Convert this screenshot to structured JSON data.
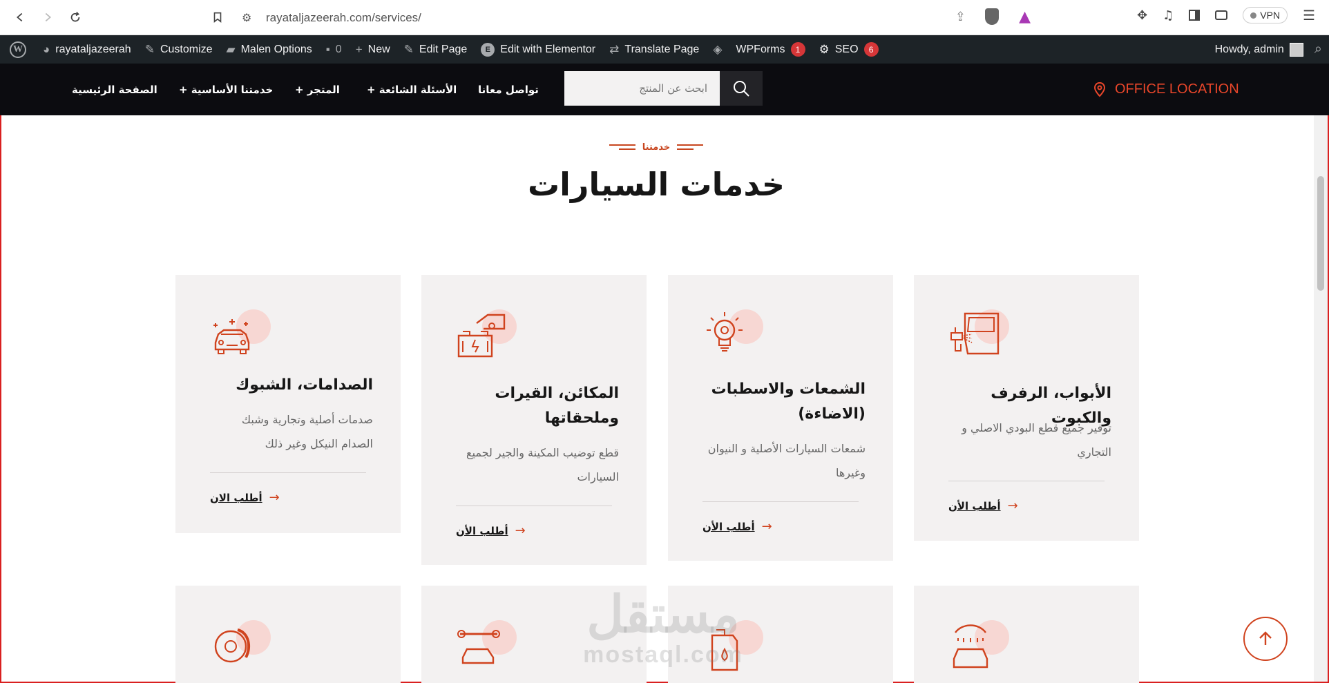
{
  "browser": {
    "url": "rayataljazeerah.com/services/",
    "vpn_label": "VPN"
  },
  "wp_admin": {
    "site": "rayataljazeerah",
    "customize": "Customize",
    "theme_options": "Malen Options",
    "comments": "0",
    "new": "New",
    "edit_page": "Edit Page",
    "edit_elementor": "Edit with Elementor",
    "translate": "Translate Page",
    "wpforms": "WPForms",
    "wpforms_count": "1",
    "seo": "SEO",
    "seo_count": "6",
    "howdy": "Howdy, admin"
  },
  "header": {
    "menu": [
      "الصفحة الرئيسية",
      "خدمتنا الأساسية +",
      "المتجر +",
      "الأسئلة الشائعة +",
      "تواصل معانا"
    ],
    "search_placeholder": "ابحث عن المنتج",
    "office": "OFFICE LOCATION"
  },
  "section": {
    "eyebrow": "خدمتنا",
    "title": "خدمات السيارات"
  },
  "cards": [
    {
      "title": "الصدامات، الشبوك",
      "desc": "صدمات أصلية وتجارية وشبك الصدام النيكل وغير ذلك",
      "link": "أطلب الان",
      "icon": "car-sparkle-icon"
    },
    {
      "title": "المكائن، القيرات وملحقاتها",
      "desc": "قطع توضيب المكينة والجير لجميع السيارات",
      "link": "أطلب الأن",
      "icon": "engine-battery-icon"
    },
    {
      "title": "الشمعات والاسطبات (الاضاءة)",
      "desc": "شمعات السيارات الأصلية و النيوان وغيرها",
      "link": "أطلب الأن",
      "icon": "lightbulb-icon"
    },
    {
      "title": "الأبواب، الرفرف والكبوت",
      "desc": "توفير جميع قطع البودي الاصلي و التجاري",
      "link": "أطلب الأن",
      "icon": "car-door-spray-icon"
    }
  ],
  "watermark": {
    "line1": "مستقل",
    "line2": "mostaql.com"
  },
  "colors": {
    "accent": "#d0431e",
    "office": "#e8462a",
    "card_bg": "#f3f1f1",
    "header_bg": "#0c0c10",
    "wp_bar": "#1d2327"
  }
}
